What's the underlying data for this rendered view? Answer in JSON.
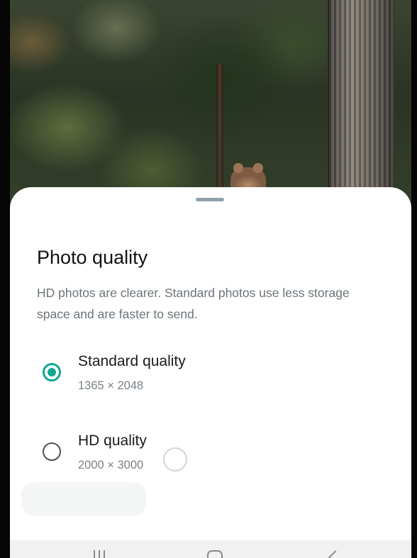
{
  "sheet": {
    "title": "Photo quality",
    "description": "HD photos are clearer. Standard photos use less storage space and are faster to send.",
    "options": [
      {
        "label": "Standard quality",
        "dimensions": "1365 × 2048",
        "selected": true
      },
      {
        "label": "HD quality",
        "dimensions": "2000 × 3000",
        "selected": false
      }
    ]
  },
  "colors": {
    "accent": "#11a88e",
    "sheet_bg": "#ffffff",
    "title_text": "#121212",
    "secondary_text": "#6d7479"
  },
  "icons": {
    "nav_recent": "recent-apps-icon",
    "nav_home": "home-icon",
    "nav_back": "back-icon"
  }
}
